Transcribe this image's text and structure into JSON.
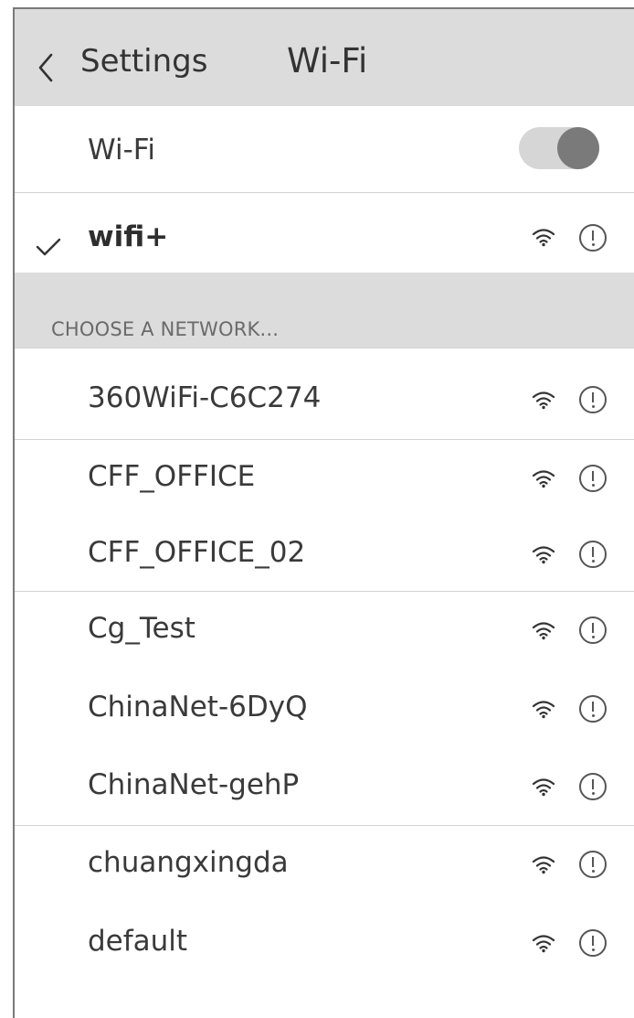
{
  "navbar": {
    "back_label": "Settings",
    "title": "Wi-Fi"
  },
  "wifi_toggle": {
    "label": "Wi-Fi",
    "enabled": true
  },
  "connected_network": {
    "name": "wifi+",
    "check_icon": "checkmark-icon",
    "signal_icon": "wifi-signal-icon",
    "info_icon": "info-icon"
  },
  "section": {
    "header": "CHOOSE A NETWORK..."
  },
  "networks": [
    {
      "name": "360WiFi-C6C274"
    },
    {
      "name": "CFF_OFFICE"
    },
    {
      "name": "CFF_OFFICE_02"
    },
    {
      "name": "Cg_Test"
    },
    {
      "name": "ChinaNet-6DyQ"
    },
    {
      "name": "ChinaNet-gehP"
    },
    {
      "name": "chuangxingda"
    },
    {
      "name": "default"
    }
  ]
}
